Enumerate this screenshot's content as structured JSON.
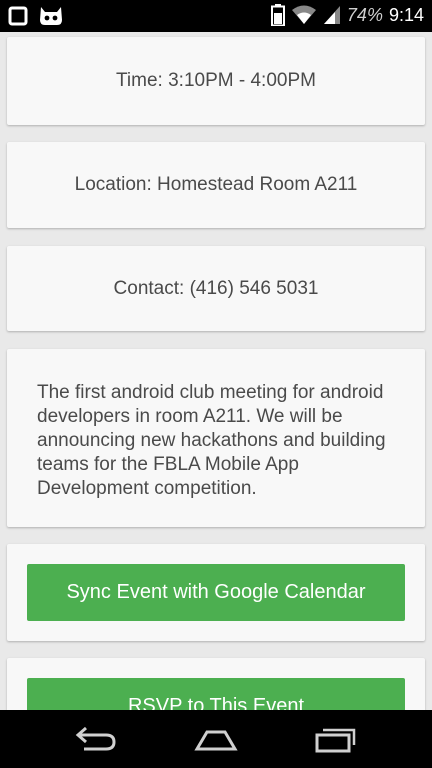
{
  "status_bar": {
    "battery_percent": "74%",
    "time": "9:14",
    "icons": [
      "notification-square-icon",
      "cyanogen-mod-icon",
      "battery-icon",
      "wifi-icon",
      "signal-icon"
    ]
  },
  "cards": {
    "time": "Time: 3:10PM - 4:00PM",
    "location": "Location: Homestead Room A211",
    "contact": "Contact: (416) 546 5031",
    "description": "The first android club meeting for android developers in room A211. We will be announcing new hackathons and building teams for the FBLA Mobile App Development competition."
  },
  "buttons": {
    "sync_label": "Sync Event with Google Calendar",
    "rsvp_label": "RSVP to This Event",
    "color": "#4caf50"
  },
  "nav_bar": {
    "icons": [
      "back-icon",
      "home-icon",
      "recent-apps-icon"
    ]
  }
}
